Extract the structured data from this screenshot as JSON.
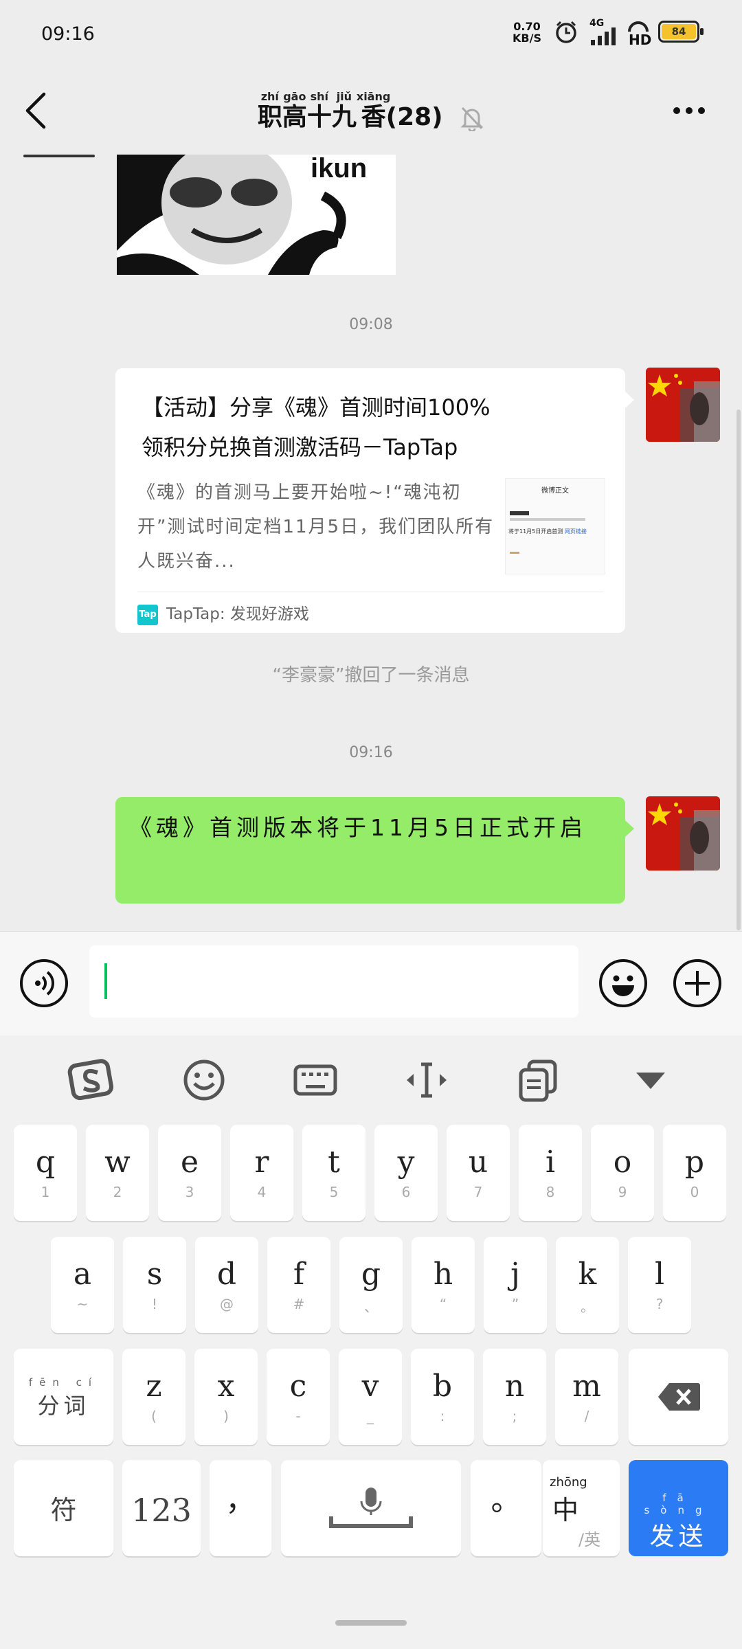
{
  "status_bar": {
    "time": "09:16",
    "net_speed_value": "0.70",
    "net_speed_unit": "KB/S",
    "signal_label": "4G",
    "hd_label": "HD",
    "battery": "84"
  },
  "header": {
    "title": "职高十九香(28)",
    "title_pinyin": [
      "zhí",
      "gāo",
      "shí",
      "jiǔ",
      "xiāng"
    ],
    "title_chars": [
      "职",
      "高",
      "十",
      "九",
      "香"
    ],
    "title_count": "(28)"
  },
  "chat": {
    "meme_caption": "ikun",
    "timestamp_1": "09:08",
    "link_card": {
      "title": "【活动】分享《魂》首测时间100%领积分兑换首测激活码－TapTap",
      "description": "《魂》的首测马上要开始啦~!“魂沌初开”测试时间定档11月5日，我们团队所有人既兴奋...",
      "thumb_heading": "微博正文",
      "thumb_line": "将于11月5日开启首测",
      "thumb_link": "网页链接",
      "source": "TapTap: 发现好游戏"
    },
    "recall_notice": "“李豪豪”撤回了一条消息",
    "timestamp_2": "09:16",
    "sent_message": "《魂》首测版本将于11月5日正式开启"
  },
  "input_bar": {
    "text_value": ""
  },
  "keyboard": {
    "row1": [
      {
        "key": "q",
        "sub": "1"
      },
      {
        "key": "w",
        "sub": "2"
      },
      {
        "key": "e",
        "sub": "3"
      },
      {
        "key": "r",
        "sub": "4"
      },
      {
        "key": "t",
        "sub": "5"
      },
      {
        "key": "y",
        "sub": "6"
      },
      {
        "key": "u",
        "sub": "7"
      },
      {
        "key": "i",
        "sub": "8"
      },
      {
        "key": "o",
        "sub": "9"
      },
      {
        "key": "p",
        "sub": "0"
      }
    ],
    "row2": [
      {
        "key": "a",
        "sub": "~"
      },
      {
        "key": "s",
        "sub": "!"
      },
      {
        "key": "d",
        "sub": "@"
      },
      {
        "key": "f",
        "sub": "#"
      },
      {
        "key": "g",
        "sub": "、"
      },
      {
        "key": "h",
        "sub": "“"
      },
      {
        "key": "j",
        "sub": "”"
      },
      {
        "key": "k",
        "sub": "。"
      },
      {
        "key": "l",
        "sub": "?"
      }
    ],
    "row3_left": "分词",
    "row3": [
      {
        "key": "z",
        "sub": "("
      },
      {
        "key": "x",
        "sub": ")"
      },
      {
        "key": "c",
        "sub": "-"
      },
      {
        "key": "v",
        "sub": "_"
      },
      {
        "key": "b",
        "sub": ":"
      },
      {
        "key": "n",
        "sub": ";"
      },
      {
        "key": "m",
        "sub": "/"
      }
    ],
    "symbol_key": "符",
    "number_key": "123",
    "comma_key": "，",
    "period_key": "。",
    "lang_main": "中",
    "lang_sub": "/英",
    "send_key": "发送"
  },
  "colors": {
    "sent_bubble": "#95ec69",
    "send_key": "#2b7bf5",
    "caret": "#07c160"
  }
}
